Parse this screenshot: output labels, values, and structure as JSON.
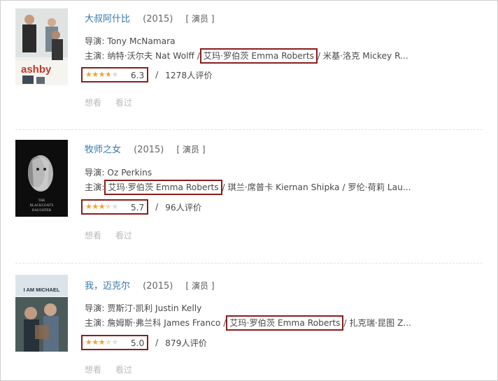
{
  "items": [
    {
      "title": "大叔阿什比",
      "year": "(2015)",
      "role": "[ 演员 ]",
      "director_label": "导演:",
      "director": "Tony McNamara",
      "cast_label": "主演:",
      "cast_before": "纳特·沃尔夫 Nat Wolff /",
      "cast_highlight": "艾玛·罗伯茨 Emma Roberts",
      "cast_after": "/ 米基·洛克 Mickey R...",
      "rating": 0.63,
      "score": "6.3",
      "slash": "/",
      "count": "1278人评价",
      "want": "想看",
      "seen": "看过",
      "poster_text": "ashby"
    },
    {
      "title": "牧师之女",
      "year": "(2015)",
      "role": "[ 演员 ]",
      "director_label": "导演:",
      "director": "Oz Perkins",
      "cast_label": "主演:",
      "cast_before": "",
      "cast_highlight": "艾玛·罗伯茨 Emma Roberts",
      "cast_after": "/ 琪兰·席普卡 Kiernan Shipka / 罗伦·荷莉 Lau...",
      "rating": 0.57,
      "score": "5.7",
      "slash": "/",
      "count": "96人评价",
      "want": "想看",
      "seen": "看过",
      "poster_text": "THE BLACKCOAT'S DAUGHTER"
    },
    {
      "title": "我，迈克尔",
      "year": "(2015)",
      "role": "[ 演员 ]",
      "director_label": "导演:",
      "director": "贾斯汀·凯利 Justin Kelly",
      "cast_label": "主演:",
      "cast_before": "詹姆斯·弗兰科 James Franco /",
      "cast_highlight": "艾玛·罗伯茨 Emma Roberts",
      "cast_after": "/ 扎克瑞·昆图 Z...",
      "rating": 0.5,
      "score": "5.0",
      "slash": "/",
      "count": "879人评价",
      "want": "想看",
      "seen": "看过",
      "poster_text": "I AM MICHAEL"
    }
  ],
  "colors": {
    "highlight_border": "#8b1c1c",
    "title_link": "#3377aa",
    "star": "#f2a22c"
  }
}
